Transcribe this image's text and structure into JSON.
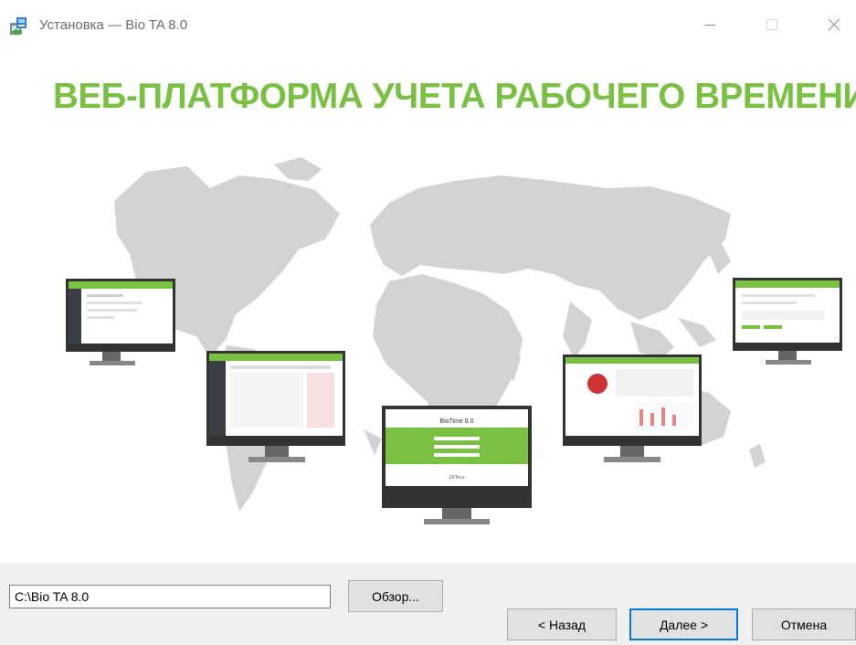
{
  "window": {
    "title": "Установка — Bio TA 8.0",
    "controls": [
      "minimize-icon",
      "maximize-icon",
      "close-icon"
    ]
  },
  "banner": {
    "headline": "ВЕБ-ПЛАТФОРМА УЧЕТА РАБОЧЕГО ВРЕМЕНИ",
    "center_screen_logo": "BioTime 8.0",
    "center_screen_brand": "ZKTeco"
  },
  "install": {
    "path_value": "C:\\Bio TA 8.0",
    "browse_label": "Обзор..."
  },
  "buttons": {
    "back_label": "< Назад",
    "next_label": "Далее >",
    "cancel_label": "Отмена"
  },
  "colors": {
    "accent_green": "#7ac143",
    "map_gray": "#d3d3d3",
    "dialog_bg": "#f0f0f0",
    "focus_blue": "#0078d7"
  }
}
